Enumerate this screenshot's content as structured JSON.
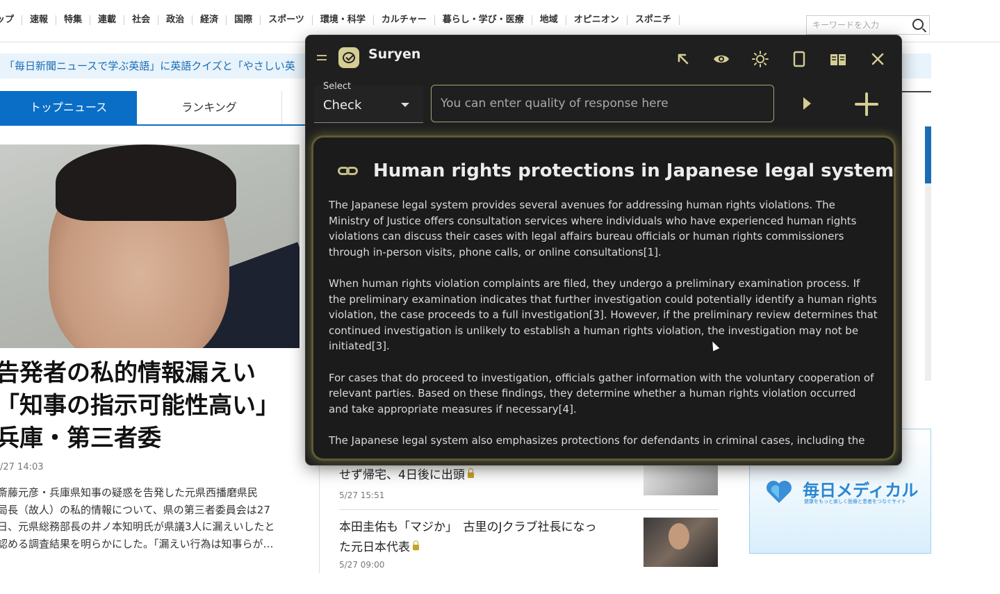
{
  "site": {
    "nav": [
      "ップ",
      "速報",
      "特集",
      "連載",
      "社会",
      "政治",
      "経済",
      "国際",
      "スポーツ",
      "環境・科学",
      "カルチャー",
      "暮らし・学び・医療",
      "地域",
      "オピニオン",
      "スポニチ"
    ],
    "search_placeholder": "キーワードを入力",
    "notice": "「毎日新聞ニュースで学ぶ英語」に英語クイズと「やさしい英",
    "tabs": {
      "top": "トップニュース",
      "ranking": "ランキング"
    },
    "headline": [
      "告発者の私的情報漏えい",
      "「知事の指示可能性高い」",
      "兵庫・第三者委"
    ],
    "headline_time": "/27 14:03",
    "lead": [
      "斎藤元彦・兵庫県知事の疑惑を告発した元県西播磨県民",
      "局長（故人）の私的情報について、県の第三者委員会は27",
      "日、元県総務部長の井ノ本知明氏が県議3人に漏えいしたと",
      "認める調査結果を明らかにした。「漏えい行為は知事らが…"
    ],
    "items": [
      {
        "title": "せず帰宅、4日後に出頭",
        "time": "5/27 15:51"
      },
      {
        "title_line1": "本田圭佑も「マジか」　古里のJクラブ社長になっ",
        "title_line2": "た元日本代表",
        "time": "5/27 09:00"
      }
    ],
    "ad": {
      "brand": "毎日メディカル",
      "tagline": "健康をもっと楽しく医療と患者をつなぐサイト"
    }
  },
  "suryen": {
    "app_name": "Suryen",
    "select_label": "Select",
    "select_value": "Check",
    "input_placeholder": "You can enter quality of response here",
    "result_title": "Human rights protections in Japanese legal system.",
    "paragraphs": [
      "The Japanese legal system provides several avenues for addressing human rights violations. The Ministry of Justice offers consultation services where individuals who have experienced human rights violations can discuss their cases with legal affairs bureau officials or human rights commissioners through in-person visits, phone calls, or online consultations[1].",
      "When human rights violation complaints are filed, they undergo a preliminary examination process. If the preliminary examination indicates that further investigation could potentially identify a human rights violation, the case proceeds to a full investigation[3]. However, if the preliminary review determines that continued investigation is unlikely to establish a human rights violation, the investigation may not be initiated[3].",
      "For cases that do proceed to investigation, officials gather information with the voluntary cooperation of relevant parties. Based on these findings, they determine whether a human rights violation occurred and take appropriate measures if necessary[4].",
      "The Japanese legal system also emphasizes protections for defendants in criminal cases, including the"
    ],
    "colors": {
      "accent": "#d4cd94",
      "panel": "#1f1f1f",
      "card": "#1b1b1b"
    },
    "icons": [
      "hamburger-icon",
      "suryen-logo-icon",
      "arrow-up-left-icon",
      "eye-icon",
      "brightness-icon",
      "phone-icon",
      "book-icon",
      "close-icon",
      "play-icon",
      "plus-icon",
      "link-icon"
    ]
  }
}
